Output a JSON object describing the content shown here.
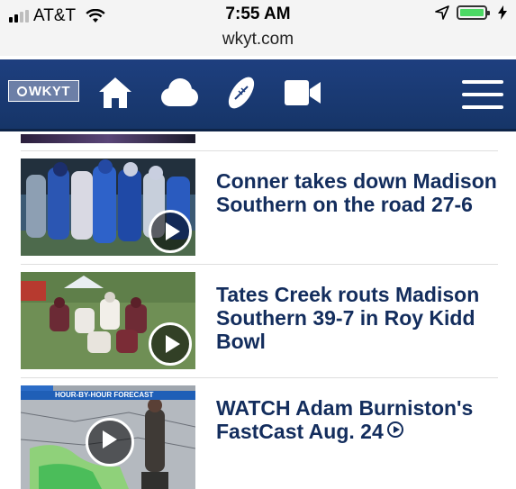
{
  "status_bar": {
    "carrier": "AT&T",
    "time": "7:55 AM",
    "url": "wkyt.com",
    "battery_color": "#4cd964"
  },
  "nav": {
    "logo_text": "WKYT",
    "icons": [
      "home-icon",
      "weather-cloud-icon",
      "football-icon",
      "video-camera-icon",
      "hamburger-menu-icon"
    ],
    "background": "#1e3f7f"
  },
  "stories": [
    {
      "headline": "Conner takes down Madison Southern on the road 27-6"
    },
    {
      "headline": "Tates Creek routs Madison Southern 39-7 in Roy Kidd Bowl"
    },
    {
      "headline": "WATCH Adam Burniston's FastCast Aug. 24",
      "forecast_label": "HOUR-BY-HOUR FORECAST"
    }
  ],
  "colors": {
    "headline": "#132d5d",
    "navbar": "#1e3f7f"
  }
}
